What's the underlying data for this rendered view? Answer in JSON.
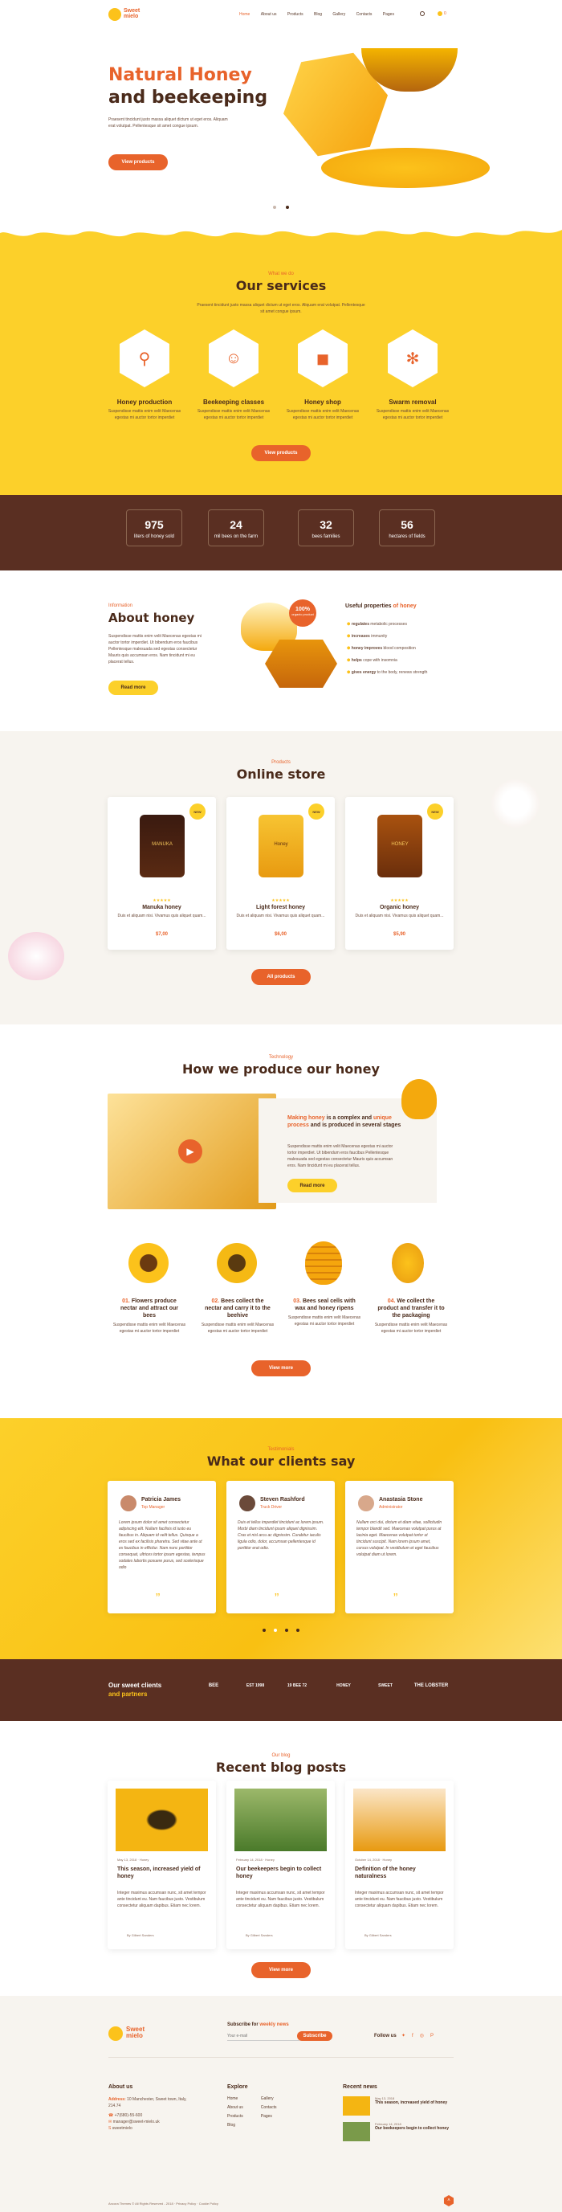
{
  "header": {
    "brand_line1": "Sweet",
    "brand_line2": "mielo",
    "nav": [
      "Home",
      "About us",
      "Products",
      "Blog",
      "Gallery",
      "Contacts",
      "Pages"
    ],
    "cart_count": "0"
  },
  "hero": {
    "title1": "Natural Honey",
    "title2": "and beekeeping",
    "text1": "Praesent tincidunt justo massa aliquet dictum ut eget eros. Aliquam",
    "text2": "erat volutpat. Pellentesque sit amet congue ipsum.",
    "button": "View products"
  },
  "services": {
    "caption": "What we do",
    "title": "Our services",
    "intro1": "Praesent tincidunt justo massa aliquet dictum ut eget eros. Aliquam erat volutpat. Pellentesque",
    "intro2": "sit amet congue ipsum.",
    "items": [
      {
        "title": "Honey production",
        "text": "Suspendisse mattis enim velit Maecenas egestas mi auctor tortor imperdiet"
      },
      {
        "title": "Beekeeping classes",
        "text": "Suspendisse mattis enim velit Maecenas egestas mi auctor tortor imperdiet"
      },
      {
        "title": "Honey shop",
        "text": "Suspendisse mattis enim velit Maecenas egestas mi auctor tortor imperdiet"
      },
      {
        "title": "Swarm removal",
        "text": "Suspendisse mattis enim velit Maecenas egestas mi auctor tortor imperdiet"
      }
    ],
    "button": "View products"
  },
  "stats": [
    {
      "value": "975",
      "label": "liters of honey sold"
    },
    {
      "value": "24",
      "label": "mil bees on the farm"
    },
    {
      "value": "32",
      "label": "bees families"
    },
    {
      "value": "56",
      "label": "hectares of fields"
    }
  ],
  "about": {
    "caption": "Information",
    "title": "About honey",
    "text": "Suspendisse mattis enim velit Maecenas egestas mi auctor tortor imperdiet. Ut bibendum eros faucibus Pellentesque malesuada sed egestas consectetur Mauris quis accumsan eros. Nam tincidunt mi eu placerat tellus.",
    "button": "Read more",
    "badge1": "100%",
    "badge2": "organic product",
    "props_title1": "Useful properties",
    "props_title2": "of honey",
    "props": [
      {
        "b": "regulates",
        "t": "metabolic processes"
      },
      {
        "b": "increases",
        "t": "immunity"
      },
      {
        "b": "honey improves",
        "t": "blood composition"
      },
      {
        "b": "helps",
        "t": "cope with insomnia"
      },
      {
        "b": "gives energy",
        "t": "to the body, renews strength"
      }
    ]
  },
  "store": {
    "caption": "Products",
    "title": "Online store",
    "products": [
      {
        "name": "Manuka honey",
        "text": "Duis et aliquam nisi. Vivamus quis aliquet quam...",
        "price": "$7,00",
        "badge": "NEW",
        "jar": "MANUKA"
      },
      {
        "name": "Light forest honey",
        "text": "Duis et aliquam nisi. Vivamus quis aliquet quam...",
        "price": "$6,00",
        "badge": "NEW",
        "jar": "Honey"
      },
      {
        "name": "Organic honey",
        "text": "Duis et aliquam nisi. Vivamus quis aliquet quam...",
        "price": "$5,90",
        "badge": "NEW",
        "jar": "HONEY"
      }
    ],
    "button": "All products"
  },
  "produce": {
    "caption": "Technology",
    "title": "How we produce our honey",
    "headline_a": "Making honey",
    "headline_b": " is a complex and ",
    "headline_c": "unique process",
    "headline_d": " and is produced in several stages",
    "text": "Suspendisse mattis enim velit Maecenas egestas mi auctor tortor imperdiet. Ut bibendum eros faucibus Pellentesque malesuada sed egestas consectetur Mauris quis accumsan eros. Nam tincidunt mi eu placerat tellus.",
    "button": "Read more",
    "steps": [
      {
        "num": "01.",
        "l1": " Flowers produce",
        "l2": "nectar and attract our",
        "l3": "bees",
        "text": "Suspendisse mattis enim velit Maecenas egestas mi auctor tortor imperdiet"
      },
      {
        "num": "02.",
        "l1": " Bees collect the",
        "l2": "nectar and carry it to the",
        "l3": "beehive",
        "text": "Suspendisse mattis enim velit Maecenas egestas mi auctor tortor imperdiet"
      },
      {
        "num": "03.",
        "l1": " Bees seal cells with",
        "l2": "wax and honey ripens",
        "l3": "",
        "text": "Suspendisse mattis enim velit Maecenas egestas mi auctor tortor imperdiet"
      },
      {
        "num": "04.",
        "l1": " We collect the",
        "l2": "product and transfer it to",
        "l3": "the packaging",
        "text": "Suspendisse mattis enim velit Maecenas egestas mi auctor tortor imperdiet"
      }
    ],
    "button2": "View more"
  },
  "testimonials": {
    "caption": "Testimonials",
    "title": "What our clients say",
    "items": [
      {
        "name": "Patricia James",
        "role": "Top Manager",
        "text": "Lorem ipsum dolor sit amet consectetur adipiscing elit. Nullam facilisis id iusto eu faucibus in. Aliquam id velit tellus. Quisque a eros sed ex facilisis pharetra. Sed vitae ante ut ex faucibus in efficitur. Nam nunc porttitor consequat, ultrices tortor ipsum egestas, tempus sodales lobortis posuere purus, sed scelerisque odio"
      },
      {
        "name": "Steven Rashford",
        "role": "Truck Driver",
        "text": "Duis et tellus imperdiet tincidunt ac lorem ipsum. Morbi diam tincidunt ipsum aliquet dignissim. Cras et nisl arcu ac dignissim. Curabitur iaculis ligula odio, dolor, accumsan pellentesque id porttitor erat odio."
      },
      {
        "name": "Anastasia Stone",
        "role": "Administrator",
        "text": "Nullam orci dui, dictum et diam vitae, sollicitudin tempor blandit sed. Maecenas volutpat purus at lacinia eget. Maecenas volutpat tortor ut tincidunt suscipit. Nam lorem ipsum amet, cursus volutpat. In vestibulum et eget faucibus volutpat diam ut lorem."
      }
    ]
  },
  "partners": {
    "title1": "Our sweet clients",
    "title2": "and partners",
    "logos": [
      "BEE",
      "EST 1998",
      "19 BEE 72",
      "HONEY",
      "SWEET",
      "THE LOBSTER"
    ]
  },
  "blog": {
    "caption": "Our blog",
    "title": "Recent blog posts",
    "posts": [
      {
        "date": "May 13, 2018",
        "cat": "Honey",
        "title": "This season, increased yield of honey",
        "text": "Integer maximus accumsan nunc, sit amet tempor ante tincidunt eu. Nam faucibus justo. Vestibulum consectetur aliquam dapibus. Etiam nec lorem.",
        "author": "By Gilbert Sanders"
      },
      {
        "date": "February 14, 2018",
        "cat": "Honey",
        "title": "Our beekeepers begin to collect honey",
        "text": "Integer maximus accumsan nunc, sit amet tempor ante tincidunt eu. Nam faucibus justo. Vestibulum consectetur aliquam dapibus. Etiam nec lorem.",
        "author": "By Gilbert Sanders"
      },
      {
        "date": "October 14, 2018",
        "cat": "Honey",
        "title": "Definition of the honey naturalness",
        "text": "Integer maximus accumsan nunc, sit amet tempor ante tincidunt eu. Nam faucibus justo. Vestibulum consectetur aliquam dapibus. Etiam nec lorem.",
        "author": "By Gilbert Sanders"
      }
    ],
    "button": "View more"
  },
  "footer": {
    "brand1": "Sweet",
    "brand2": "mielo",
    "subscribe_title1": "Subscribe for",
    "subscribe_title2": "weekly news",
    "subscribe_placeholder": "Your e-mail",
    "subscribe_button": "Subscribe",
    "follow": "Follow us",
    "about_title": "About us",
    "address_label": "Address:",
    "address": "10 Manchester, Sweet town, Italy, 214.74",
    "phone": "+7(680)-55-600",
    "email": "manager@sweet-mielo.uk",
    "skype": "sweetmielo",
    "explore_title": "Explore",
    "explore_col1": [
      "Home",
      "About us",
      "Products",
      "Blog"
    ],
    "explore_col2": [
      "Gallery",
      "Contacts",
      "Pages"
    ],
    "news_title": "Recent news",
    "news": [
      {
        "date": "May 13, 2018",
        "title": "This season, increased yield of honey"
      },
      {
        "date": "February 14, 2018",
        "title": "Our beekeepers begin to collect honey"
      }
    ],
    "copyright": "Ancora Themes © All Rights Reserved - 2018 · Privacy Policy · Cookie Policy"
  },
  "colors": {
    "accent": "#e8632b",
    "yellow": "#fcd02a",
    "brown": "#5a2f22"
  }
}
